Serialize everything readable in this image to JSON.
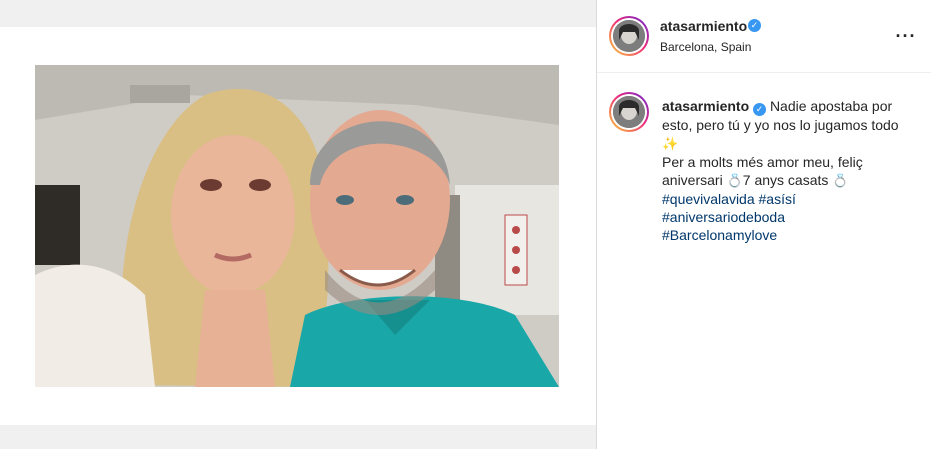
{
  "post": {
    "username": "atasarmiento",
    "location": "Barcelona, Spain",
    "more_icon": "···",
    "caption": {
      "line1_rest": "Nadie apostaba por esto, pero tú y yo nos lo jugamos todo",
      "sparkle": "✨",
      "line2_a": "Per a molts més amor meu, feliç aniversari ",
      "ring1": "💍",
      "line2_b": "7 anys casats ",
      "ring2": "💍",
      "hashtags": [
        "#quevivalavida #asísí",
        "#aniversariodeboda",
        "#Barcelonamylove"
      ]
    }
  },
  "icons": {
    "verified": "verified-badge-icon",
    "more": "more-options-icon"
  },
  "colors": {
    "accent_verified": "#3897f0",
    "hashtag": "#00376b",
    "shirt": "#1aa7a8"
  }
}
